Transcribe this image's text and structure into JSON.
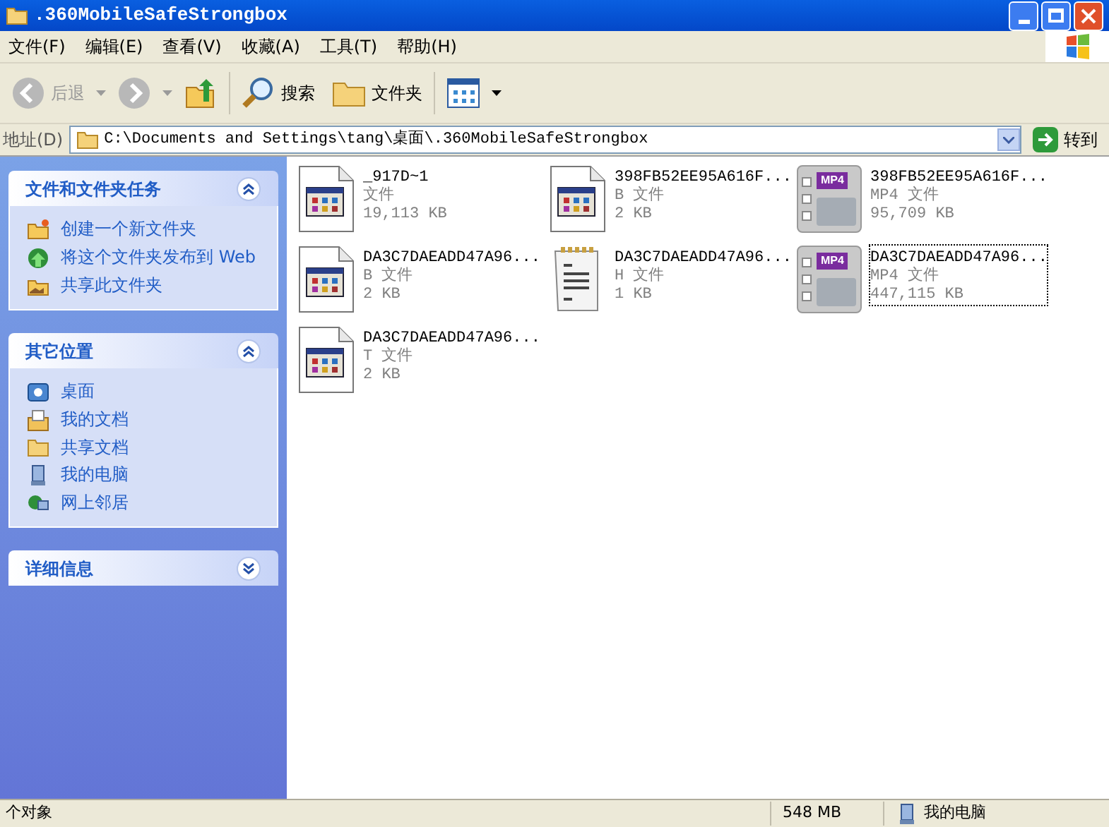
{
  "window": {
    "title": ".360MobileSafeStrongbox"
  },
  "menu": [
    "文件(F)",
    "编辑(E)",
    "查看(V)",
    "收藏(A)",
    "工具(T)",
    "帮助(H)"
  ],
  "toolbar": {
    "back": {
      "label": "后退",
      "disabled": true
    },
    "search": "搜索",
    "folders": "文件夹"
  },
  "address": {
    "label": "地址(D)",
    "value": "C:\\Documents and Settings\\tang\\桌面\\.360MobileSafeStrongbox",
    "go": "转到"
  },
  "panels": [
    {
      "title": "文件和文件夹任务",
      "expanded": true,
      "items": [
        {
          "label": "创建一个新文件夹"
        },
        {
          "label": "将这个文件夹发布到 Web"
        },
        {
          "label": "共享此文件夹"
        }
      ]
    },
    {
      "title": "其它位置",
      "expanded": true,
      "items": [
        {
          "label": "桌面"
        },
        {
          "label": "我的文档"
        },
        {
          "label": "共享文档"
        },
        {
          "label": "我的电脑"
        },
        {
          "label": "网上邻居"
        }
      ]
    },
    {
      "title": "详细信息",
      "expanded": false
    }
  ],
  "files": [
    {
      "name": "_917D~1",
      "type": "文件",
      "size": "19,113 KB",
      "kind": "app",
      "focused": false
    },
    {
      "name": "398FB52EE95A616F...",
      "type": "B 文件",
      "size": "2 KB",
      "kind": "app",
      "focused": false
    },
    {
      "name": "398FB52EE95A616F...",
      "type": "MP4 文件",
      "size": "95,709 KB",
      "kind": "mp4",
      "icon_label": "MP4",
      "focused": false
    },
    {
      "name": "DA3C7DAEADD47A96...",
      "type": "B 文件",
      "size": "2 KB",
      "kind": "app",
      "focused": false
    },
    {
      "name": "DA3C7DAEADD47A96...",
      "type": "H 文件",
      "size": "1 KB",
      "kind": "text",
      "focused": false
    },
    {
      "name": "DA3C7DAEADD47A96...",
      "type": "MP4 文件",
      "size": "447,115 KB",
      "kind": "mp4",
      "icon_label": "MP4",
      "focused": true
    },
    {
      "name": "DA3C7DAEADD47A96...",
      "type": "T 文件",
      "size": "2 KB",
      "kind": "app",
      "focused": false
    }
  ],
  "status_bar": {
    "objects": "个对象",
    "size": "548 MB",
    "location": "我的电脑"
  }
}
